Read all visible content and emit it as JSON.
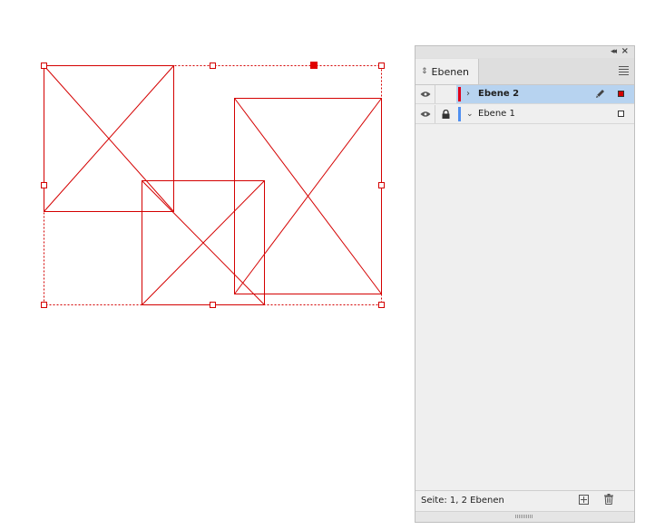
{
  "canvas": {
    "frame_color": "#d40000",
    "handle_fill": "#ffffff",
    "reference_point_fill": "#e00000"
  },
  "panel": {
    "tab_label": "Ebenen",
    "icons": {
      "collapse": "double-chevron-left-icon",
      "close": "close-icon",
      "menu": "panel-menu-icon",
      "tab_arrows": "up-down-arrows-icon"
    },
    "layers": [
      {
        "name": "Ebene 2",
        "selected": true,
        "visible": true,
        "locked": false,
        "expanded": false,
        "color": "#e0001a",
        "swatch_fill": "#d40000",
        "has_pen_icon": true
      },
      {
        "name": "Ebene 1",
        "selected": false,
        "visible": true,
        "locked": true,
        "expanded": true,
        "color": "#4f8ff0",
        "swatch_fill": "#ffffff",
        "has_pen_icon": false
      }
    ],
    "footer": {
      "status": "Seite: 1, 2 Ebenen"
    },
    "colors": {
      "selection": "#b7d3f0",
      "panel_bg": "#efefef"
    }
  }
}
